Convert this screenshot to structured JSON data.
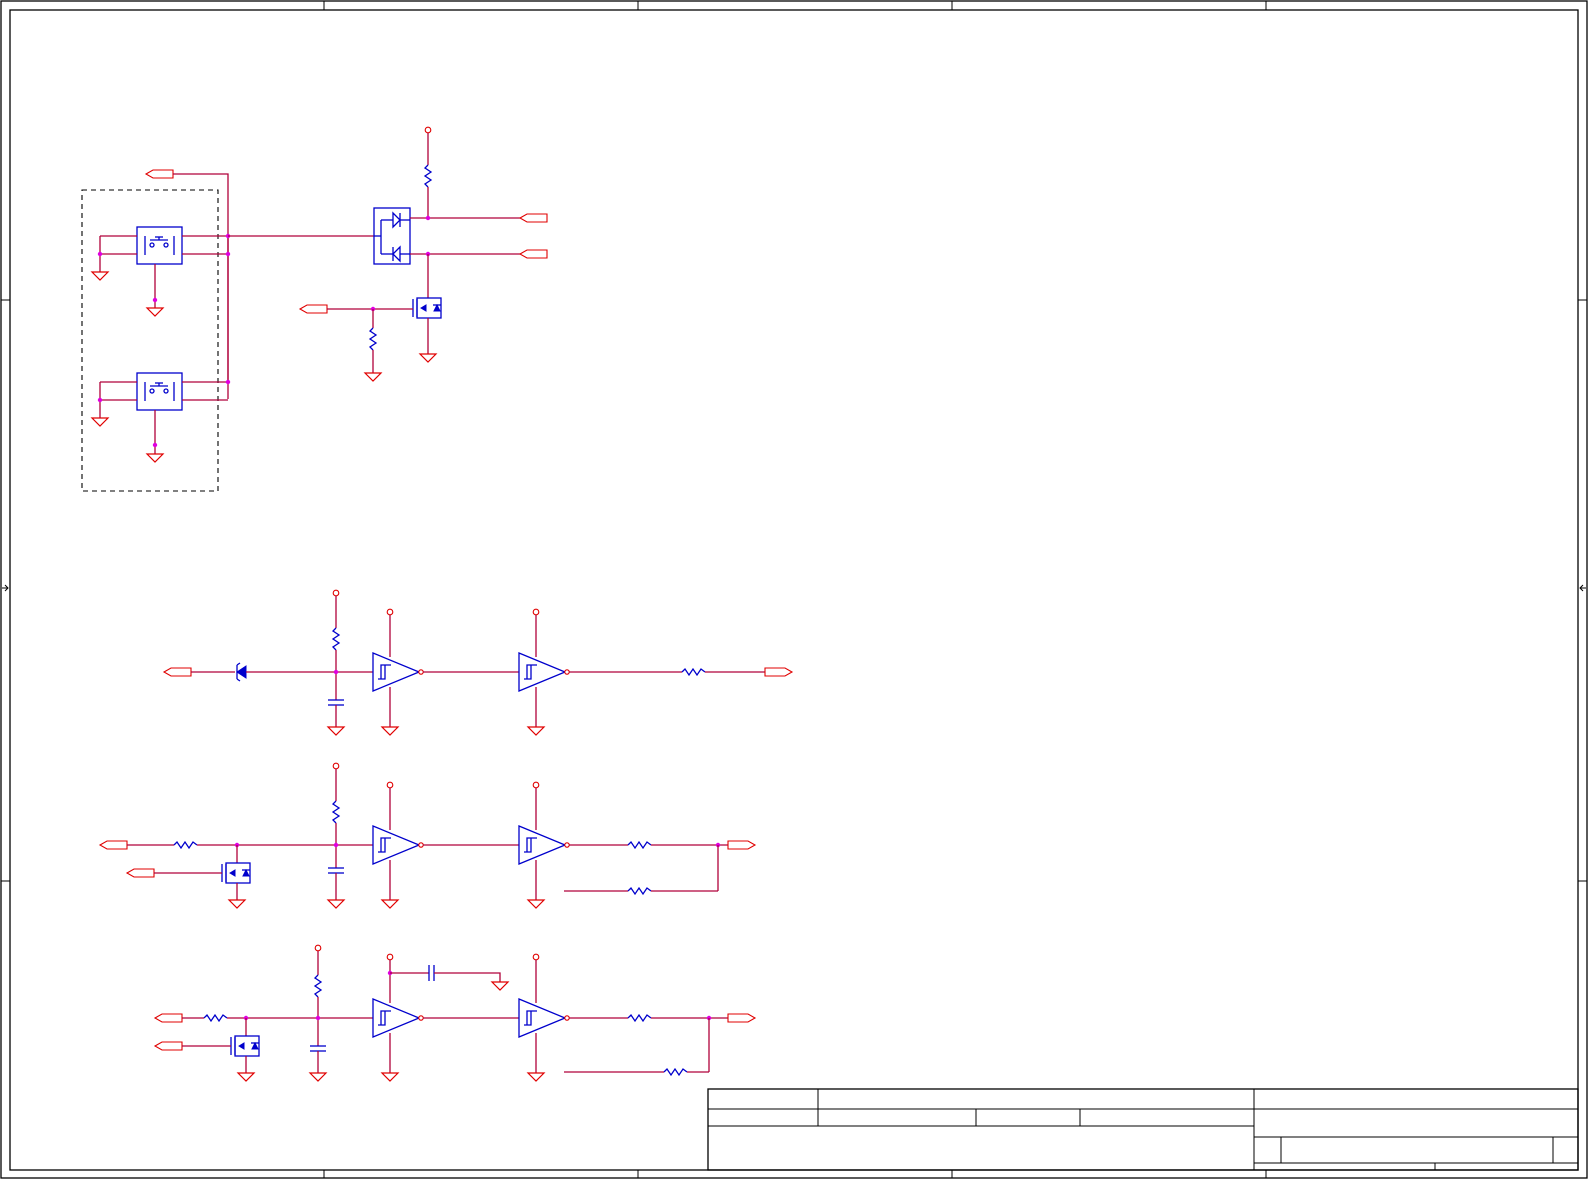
{
  "diagram": {
    "type": "electrical-schematic",
    "colors": {
      "wire": "#b0003a",
      "component": "#0000cc",
      "port": "#e00000",
      "junction": "#e000e0",
      "frame": "#000000"
    },
    "sections": [
      {
        "id": "pushbutton-switches",
        "components": [
          "pushbutton-switch",
          "pushbutton-switch",
          "dual-diode",
          "n-mosfet",
          "resistor",
          "resistor"
        ]
      },
      {
        "id": "input-chain-1",
        "components": [
          "zener-diode",
          "resistor",
          "capacitor",
          "schmitt-buffer",
          "schmitt-buffer",
          "resistor"
        ]
      },
      {
        "id": "input-chain-2",
        "components": [
          "resistor",
          "n-mosfet",
          "resistor",
          "capacitor",
          "schmitt-buffer",
          "schmitt-buffer",
          "resistor",
          "resistor"
        ]
      },
      {
        "id": "input-chain-3",
        "components": [
          "resistor",
          "n-mosfet",
          "resistor",
          "capacitor",
          "capacitor",
          "schmitt-buffer",
          "schmitt-buffer",
          "resistor",
          "resistor"
        ]
      }
    ],
    "title_block": {
      "visible": true,
      "text": ""
    }
  }
}
